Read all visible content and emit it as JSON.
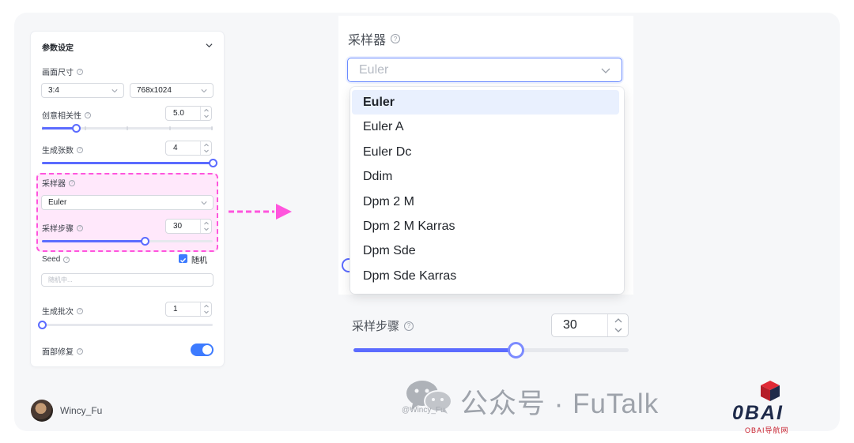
{
  "panel": {
    "title": "参数设定",
    "size_label": "画面尺寸",
    "ratio_value": "3:4",
    "resolution_value": "768x1024",
    "creativity_label": "创意相关性",
    "creativity_value": "5.0",
    "creativity_slider": 0.2,
    "count_label": "生成张数",
    "count_value": "4",
    "count_slider": 1.0,
    "sampler_label": "采样器",
    "sampler_value": "Euler",
    "steps_label": "采样步骤",
    "steps_value": "30",
    "steps_slider": 0.6,
    "seed_label": "Seed",
    "random_label": "随机",
    "random_checked": true,
    "seed_placeholder": "随机中...",
    "batch_label": "生成批次",
    "batch_value": "1",
    "batch_slider": 0.0,
    "face_fix_label": "面部修复",
    "face_fix_on": true
  },
  "author": {
    "name": "Wincy_Fu"
  },
  "zoom": {
    "sampler_label": "采样器",
    "sampler_placeholder": "Euler",
    "options": [
      "Euler",
      "Euler A",
      "Euler Dc",
      "Ddim",
      "Dpm 2 M",
      "Dpm 2 M Karras",
      "Dpm Sde",
      "Dpm Sde Karras"
    ],
    "selected_index": 0,
    "steps_label": "采样步骤",
    "steps_value": "30",
    "steps_slider": 0.59
  },
  "watermark": {
    "text": "公众号 · FuTalk",
    "handle": "@Wincy_Fu"
  },
  "logo": {
    "text": "0BAI",
    "subtitle": "OBAI导航网"
  },
  "colors": {
    "accent": "#5b6bff",
    "toggle": "#3d7bff",
    "highlight_border": "#ff55dd",
    "highlight_bg": "#ffe8fb"
  },
  "icons": [
    "chevron-down-icon",
    "question-icon",
    "spin-icon",
    "check-icon",
    "arrow-right-icon",
    "wechat-icon"
  ]
}
